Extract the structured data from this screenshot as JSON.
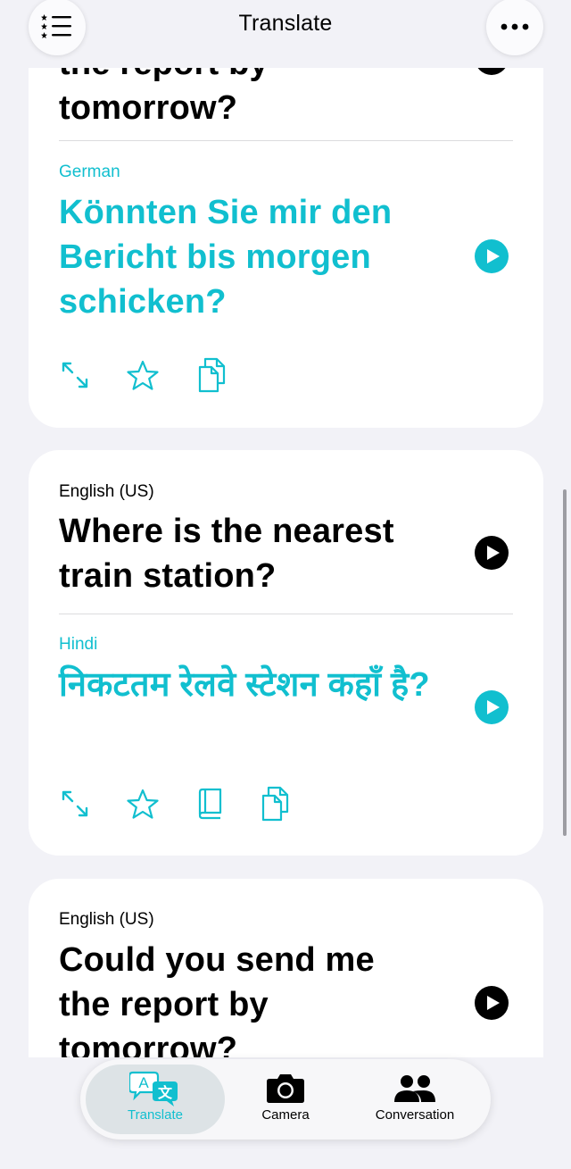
{
  "header": {
    "title": "Translate"
  },
  "cards": [
    {
      "source_tail": "the report by\ntomorrow?",
      "target_lang": "German",
      "target_text": "Könnten Sie mir den Bericht bis morgen schicken?"
    },
    {
      "source_lang": "English (US)",
      "source_text": "Where is the nearest train station?",
      "target_lang": "Hindi",
      "target_text": "निकटतम रेलवे स्टेशन कहाँ है?"
    },
    {
      "source_lang": "English (US)",
      "source_text": "Could you send me the report by tomorrow?"
    }
  ],
  "tabs": [
    {
      "label": "Translate",
      "icon": "translate-icon",
      "selected": true
    },
    {
      "label": "Camera",
      "icon": "camera-icon"
    },
    {
      "label": "Conversation",
      "icon": "people-icon"
    }
  ],
  "colors": {
    "accent": "#11bfcf",
    "background": "#f2f2f7",
    "card": "#ffffff"
  }
}
